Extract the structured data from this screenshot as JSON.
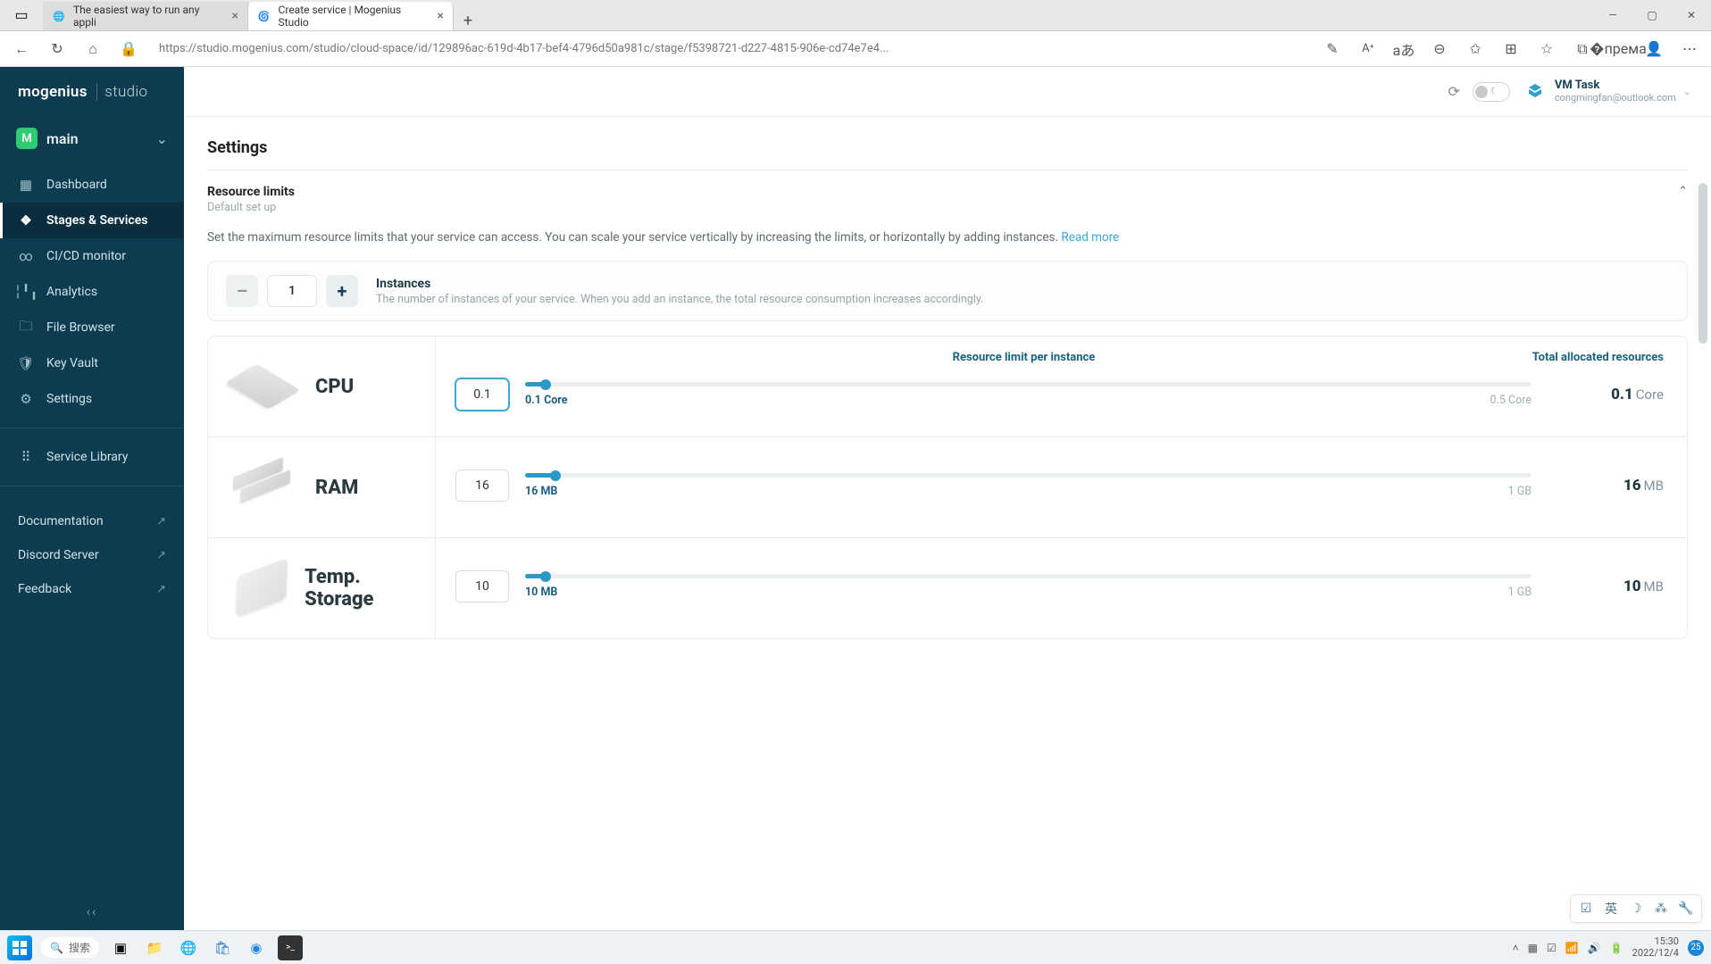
{
  "browser": {
    "tabs": [
      {
        "title": "The easiest way to run any appli",
        "icon": "🌐"
      },
      {
        "title": "Create service | Mogenius Studio",
        "icon": "🌀",
        "active": true
      }
    ],
    "url_full": "https://studio.mogenius.com/studio/cloud-space/id/129896ac-619d-4b17-bef4-4796d50a981c/stage/f5398721-d227-4815-906e-cd74e7e4..."
  },
  "logo": {
    "brand": "mogenius",
    "sub": "studio"
  },
  "project": {
    "badge": "M",
    "name": "main"
  },
  "sidebar": {
    "items": [
      {
        "icon": "▦",
        "label": "Dashboard"
      },
      {
        "icon": "❖",
        "label": "Stages & Services"
      },
      {
        "icon": "∞",
        "label": "CI/CD monitor"
      },
      {
        "icon": "╎╹╻",
        "label": "Analytics"
      },
      {
        "icon": "🗀",
        "label": "File Browser"
      },
      {
        "icon": "🛡",
        "label": "Key Vault"
      },
      {
        "icon": "⚙",
        "label": "Settings"
      }
    ],
    "library": {
      "icon": "⠿",
      "label": "Service Library"
    },
    "bottom": [
      {
        "label": "Documentation",
        "ext": "↗"
      },
      {
        "label": "Discord Server",
        "ext": "↗"
      },
      {
        "label": "Feedback",
        "ext": "↗"
      }
    ],
    "collapse": "‹‹"
  },
  "user": {
    "name": "VM Task",
    "email": "congmingfan@outlook.com"
  },
  "page": {
    "section": "Settings",
    "panel_title": "Resource limits",
    "panel_sub": "Default set up",
    "helper": "Set the maximum resource limits that your service can access. You can scale your service vertically by increasing the limits, or horizontally by adding instances.",
    "readmore": "Read more"
  },
  "instances": {
    "title": "Instances",
    "sub": "The number of instances of your service. When you add an instance, the total resource consumption increases accordingly.",
    "value": "1"
  },
  "columns": {
    "mid": "Resource limit per instance",
    "right": "Total allocated resources"
  },
  "resources": {
    "cpu": {
      "label": "CPU",
      "input": "0.1",
      "min": "0.1 Core",
      "max": "0.5 Core",
      "total_val": "0.1",
      "total_unit": "Core",
      "pct": 2
    },
    "ram": {
      "label": "RAM",
      "input": "16",
      "min": "16 MB",
      "max": "1 GB",
      "total_val": "16",
      "total_unit": "MB",
      "pct": 3
    },
    "tmp": {
      "label": "Temp. Storage",
      "input": "10",
      "min": "10 MB",
      "max": "1 GB",
      "total_val": "10",
      "total_unit": "MB",
      "pct": 2
    }
  },
  "taskbar": {
    "search": "搜索",
    "time": "15:30",
    "date": "2022/12/4",
    "ime": "英",
    "notif": "25"
  }
}
